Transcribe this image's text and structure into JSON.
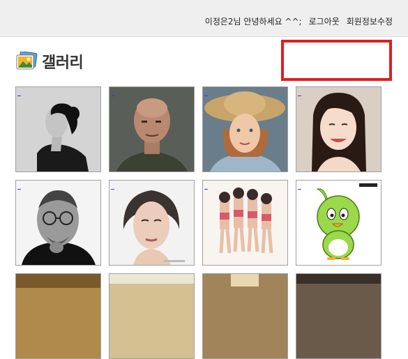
{
  "header": {
    "greeting": "이정은2님 안녕하세요 ^^;",
    "logout": "로그아웃",
    "edit_profile": "회원정보수정"
  },
  "page": {
    "title": "갤러리"
  },
  "colors": {
    "topbar_bg": "#efefef",
    "highlight_box": "#e11d20",
    "thumb_border": "#a0a0a0"
  },
  "gallery": {
    "items": [
      {
        "name": "bw-portrait-woman-profile"
      },
      {
        "name": "bald-man-portrait"
      },
      {
        "name": "girl-straw-hat"
      },
      {
        "name": "smiling-woman"
      },
      {
        "name": "bw-man-glasses"
      },
      {
        "name": "woman-portrait-dark-hair"
      },
      {
        "name": "group-dancers-photo"
      },
      {
        "name": "green-cartoon-bird"
      },
      {
        "name": "partial-image-1"
      },
      {
        "name": "partial-image-2"
      },
      {
        "name": "partial-image-3"
      },
      {
        "name": "partial-image-4"
      }
    ]
  }
}
